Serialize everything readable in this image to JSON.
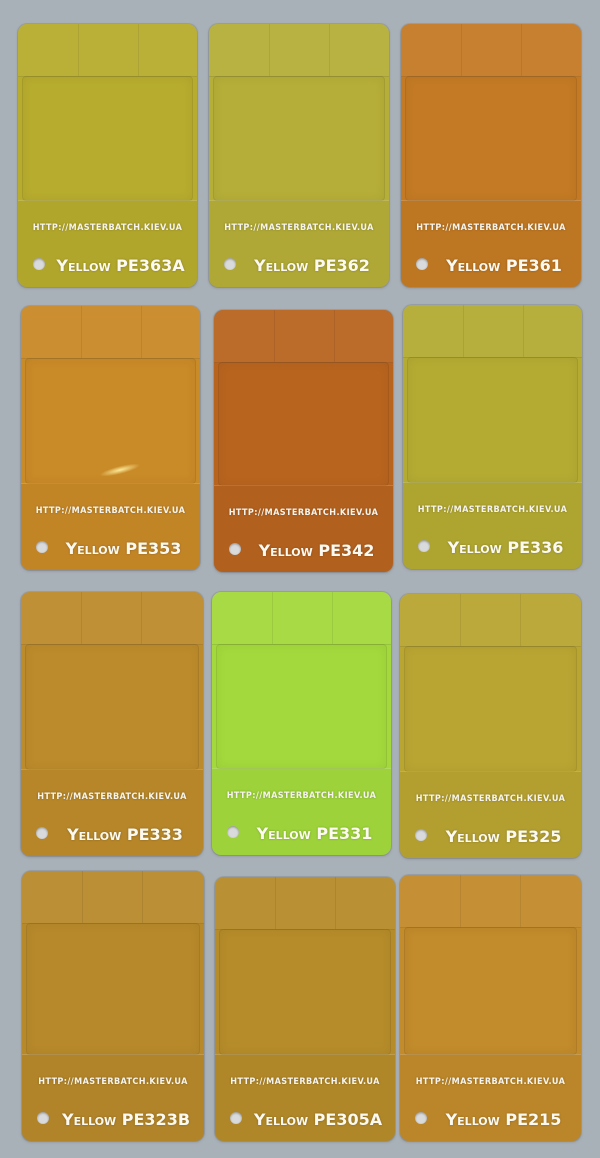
{
  "chips": [
    {
      "url": "http://masterbatch.kiev.ua",
      "name": "Yellow PE363A",
      "color": "#b7ac2e"
    },
    {
      "url": "http://masterbatch.kiev.ua",
      "name": "Yellow PE362",
      "color": "#b5ae38"
    },
    {
      "url": "http://masterbatch.kiev.ua",
      "name": "Yellow PE361",
      "color": "#c47a24"
    },
    {
      "url": "http://masterbatch.kiev.ua",
      "name": "Yellow PE353",
      "color": "#c98a28"
    },
    {
      "url": "http://masterbatch.kiev.ua",
      "name": "Yellow PE342",
      "color": "#b8641f"
    },
    {
      "url": "http://masterbatch.kiev.ua",
      "name": "Yellow PE336",
      "color": "#b4ab33"
    },
    {
      "url": "http://masterbatch.kiev.ua",
      "name": "Yellow PE333",
      "color": "#bc8b2b"
    },
    {
      "url": "http://masterbatch.kiev.ua",
      "name": "Yellow PE331",
      "color": "#a3d93c"
    },
    {
      "url": "http://masterbatch.kiev.ua",
      "name": "Yellow PE325",
      "color": "#b9a532"
    },
    {
      "url": "http://masterbatch.kiev.ua",
      "name": "Yellow PE323B",
      "color": "#b7892b"
    },
    {
      "url": "http://masterbatch.kiev.ua",
      "name": "Yellow PE305A",
      "color": "#b68c2a"
    },
    {
      "url": "http://masterbatch.kiev.ua",
      "name": "Yellow PE215",
      "color": "#c28b2b"
    }
  ]
}
